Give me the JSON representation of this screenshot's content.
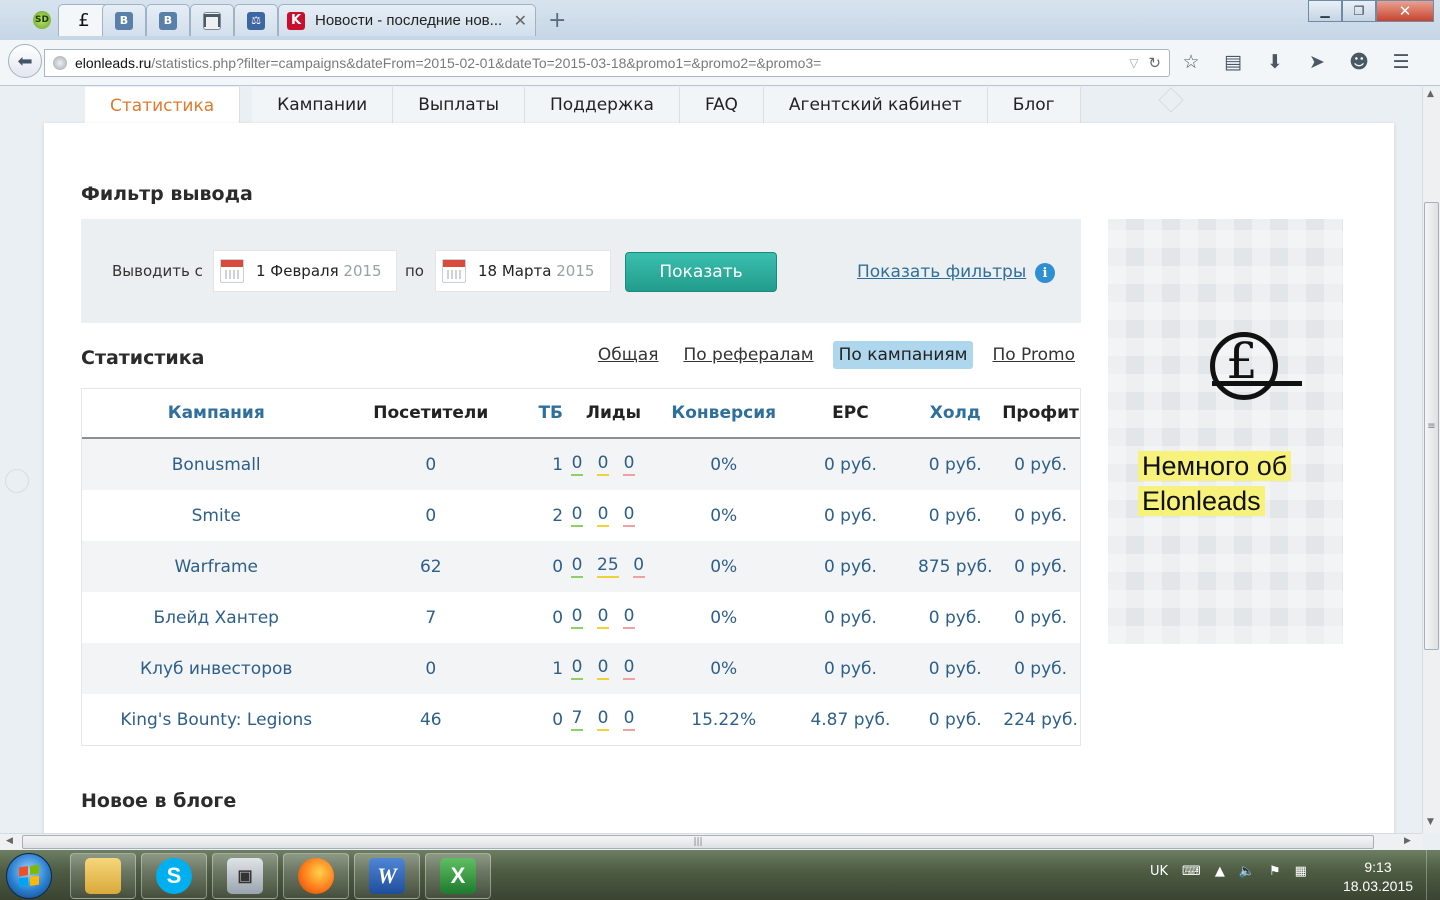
{
  "browser": {
    "tabs": [
      {
        "icon": "sd-icon",
        "text": "SD"
      },
      {
        "icon": "elonleads-icon",
        "text": "£"
      },
      {
        "icon": "vk-icon",
        "text": "В"
      },
      {
        "icon": "vk-icon",
        "text": "В"
      },
      {
        "icon": "bank-icon",
        "text": ""
      },
      {
        "icon": "scales-icon",
        "text": "⚖"
      }
    ],
    "active_tab": {
      "icon": "k-icon",
      "favicon_text": "K",
      "title": "Новости - последние нов...",
      "close": "✕"
    },
    "new_tab": "+",
    "window": {
      "minimize": "▁",
      "maximize": "❐",
      "close": "✕"
    },
    "url": {
      "host": "elonleads.ru",
      "path": "/statistics.php?filter=campaigns&dateFrom=2015-02-01&dateTo=2015-03-18&promo1=&promo2=&promo3="
    }
  },
  "site": {
    "nav": [
      "Статистика",
      "Кампании",
      "Выплаты",
      "Поддержка",
      "FAQ",
      "Агентский кабинет",
      "Блог"
    ],
    "active_nav_index": 0
  },
  "filter": {
    "heading": "Фильтр вывода",
    "label_from": "Выводить с",
    "date_from": {
      "day_month": "1 Февраля",
      "year": "2015"
    },
    "label_to": "по",
    "date_to": {
      "day_month": "18 Марта",
      "year": "2015"
    },
    "show_button": "Показать",
    "show_filters_link": "Показать фильтры",
    "info": "i"
  },
  "stats": {
    "heading": "Статистика",
    "tabs": [
      "Общая",
      "По рефералам",
      "По кампаниям",
      "По Promo"
    ],
    "active_tab_index": 2,
    "columns": {
      "campaign": "Кампания",
      "visitors": "Посетители",
      "tb": "ТБ",
      "leads": "Лиды",
      "conversion": "Конверсия",
      "epc": "EPC",
      "hold": "Холд",
      "profit": "Профит"
    },
    "rows": [
      {
        "campaign": "Bonusmall",
        "visitors": "0",
        "tb": "1",
        "leads_green": "0",
        "leads_yellow": "0",
        "leads_red": "0",
        "conversion": "0%",
        "epc": "0 руб.",
        "hold": "0 руб.",
        "profit": "0 руб."
      },
      {
        "campaign": "Smite",
        "visitors": "0",
        "tb": "2",
        "leads_green": "0",
        "leads_yellow": "0",
        "leads_red": "0",
        "conversion": "0%",
        "epc": "0 руб.",
        "hold": "0 руб.",
        "profit": "0 руб."
      },
      {
        "campaign": "Warframe",
        "visitors": "62",
        "tb": "0",
        "leads_green": "0",
        "leads_yellow": "25",
        "leads_red": "0",
        "conversion": "0%",
        "epc": "0 руб.",
        "hold": "875 руб.",
        "profit": "0 руб."
      },
      {
        "campaign": "Блейд Хантер",
        "visitors": "7",
        "tb": "0",
        "leads_green": "0",
        "leads_yellow": "0",
        "leads_red": "0",
        "conversion": "0%",
        "epc": "0 руб.",
        "hold": "0 руб.",
        "profit": "0 руб."
      },
      {
        "campaign": "Клуб инвесторов",
        "visitors": "0",
        "tb": "1",
        "leads_green": "0",
        "leads_yellow": "0",
        "leads_red": "0",
        "conversion": "0%",
        "epc": "0 руб.",
        "hold": "0 руб.",
        "profit": "0 руб."
      },
      {
        "campaign": "King's Bounty: Legions",
        "visitors": "46",
        "tb": "0",
        "leads_green": "7",
        "leads_yellow": "0",
        "leads_red": "0",
        "conversion": "15.22%",
        "epc": "4.87 руб.",
        "hold": "0 руб.",
        "profit": "224 руб."
      }
    ]
  },
  "blog": {
    "heading": "Новое в блоге"
  },
  "banner": {
    "line1": "Немного об",
    "line2": "Elonleads",
    "logo": "£"
  },
  "taskbar": {
    "apps": [
      "explorer-icon",
      "skype-icon",
      "printer-app-icon",
      "firefox-icon",
      "word-icon",
      "excel-icon"
    ],
    "lang": "UK",
    "time": "9:13",
    "date": "18.03.2015"
  },
  "colors": {
    "accent_orange": "#e07a2c",
    "button_teal": "#2aab9a",
    "link_blue": "#2e6f9c",
    "active_tab_bg": "#aed6ec"
  }
}
